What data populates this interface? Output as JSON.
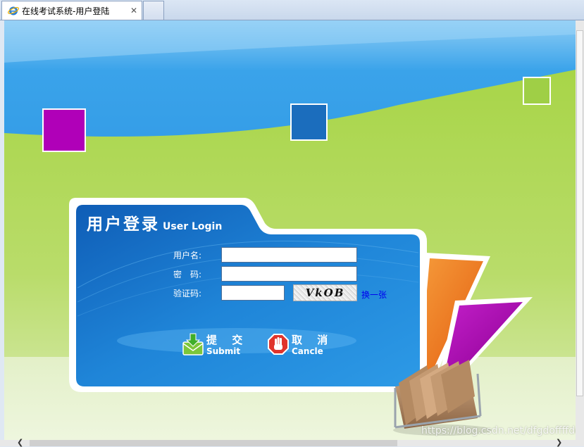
{
  "browser": {
    "tab_title": "在线考试系统-用户登陆",
    "tab_close": "✕"
  },
  "login": {
    "title_cn": "用户登录",
    "title_en": "User Login",
    "username_label": "用户名:",
    "password_label": "密　码:",
    "captcha_label": "验证码:",
    "username_value": "",
    "password_value": "",
    "captcha_value": "",
    "captcha_image_text": "VkOB",
    "refresh_captcha": "换一张",
    "submit_cn": "提 交",
    "submit_en": "Submit",
    "cancel_cn": "取 消",
    "cancel_en": "Cancle"
  },
  "watermark": "https://blog.csdn.net/dfgdoffffdd",
  "colors": {
    "sky_blue": "#2791e0",
    "grass_green": "#9fcf46",
    "card_blue": "#1f7fd2",
    "magenta": "#b000b8",
    "orange": "#f07a20"
  }
}
